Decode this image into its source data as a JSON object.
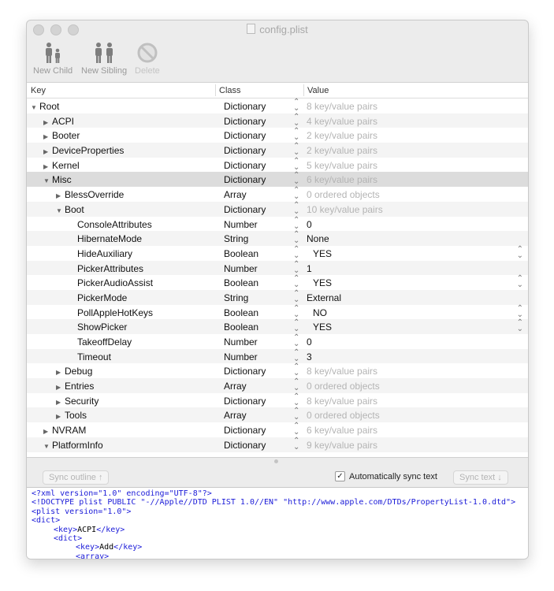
{
  "window": {
    "title": "config.plist"
  },
  "toolbar": {
    "new_child": "New Child",
    "new_sibling": "New Sibling",
    "delete": "Delete"
  },
  "table": {
    "headers": {
      "key": "Key",
      "class": "Class",
      "value": "Value"
    },
    "rows": [
      {
        "key": "Root",
        "class": "Dictionary",
        "value": "8 key/value pairs",
        "level": 0,
        "disc": "open",
        "kind": "dim"
      },
      {
        "key": "ACPI",
        "class": "Dictionary",
        "value": "4 key/value pairs",
        "level": 1,
        "disc": "closed",
        "kind": "dim"
      },
      {
        "key": "Booter",
        "class": "Dictionary",
        "value": "2 key/value pairs",
        "level": 1,
        "disc": "closed",
        "kind": "dim"
      },
      {
        "key": "DeviceProperties",
        "class": "Dictionary",
        "value": "2 key/value pairs",
        "level": 1,
        "disc": "closed",
        "kind": "dim"
      },
      {
        "key": "Kernel",
        "class": "Dictionary",
        "value": "5 key/value pairs",
        "level": 1,
        "disc": "closed",
        "kind": "dim"
      },
      {
        "key": "Misc",
        "class": "Dictionary",
        "value": "6 key/value pairs",
        "level": 1,
        "disc": "open",
        "kind": "dim",
        "selected": true
      },
      {
        "key": "BlessOverride",
        "class": "Array",
        "value": "0 ordered objects",
        "level": 2,
        "disc": "closed",
        "kind": "dim"
      },
      {
        "key": "Boot",
        "class": "Dictionary",
        "value": "10 key/value pairs",
        "level": 2,
        "disc": "open",
        "kind": "dim"
      },
      {
        "key": "ConsoleAttributes",
        "class": "Number",
        "value": "0",
        "level": 3,
        "disc": "none",
        "kind": "text"
      },
      {
        "key": "HibernateMode",
        "class": "String",
        "value": "None",
        "level": 3,
        "disc": "none",
        "kind": "text"
      },
      {
        "key": "HideAuxiliary",
        "class": "Boolean",
        "value": "YES",
        "level": 3,
        "disc": "none",
        "kind": "popup"
      },
      {
        "key": "PickerAttributes",
        "class": "Number",
        "value": "1",
        "level": 3,
        "disc": "none",
        "kind": "text"
      },
      {
        "key": "PickerAudioAssist",
        "class": "Boolean",
        "value": "YES",
        "level": 3,
        "disc": "none",
        "kind": "popup"
      },
      {
        "key": "PickerMode",
        "class": "String",
        "value": "External",
        "level": 3,
        "disc": "none",
        "kind": "text"
      },
      {
        "key": "PollAppleHotKeys",
        "class": "Boolean",
        "value": "NO",
        "level": 3,
        "disc": "none",
        "kind": "popup"
      },
      {
        "key": "ShowPicker",
        "class": "Boolean",
        "value": "YES",
        "level": 3,
        "disc": "none",
        "kind": "popup"
      },
      {
        "key": "TakeoffDelay",
        "class": "Number",
        "value": "0",
        "level": 3,
        "disc": "none",
        "kind": "text"
      },
      {
        "key": "Timeout",
        "class": "Number",
        "value": "3",
        "level": 3,
        "disc": "none",
        "kind": "text"
      },
      {
        "key": "Debug",
        "class": "Dictionary",
        "value": "8 key/value pairs",
        "level": 2,
        "disc": "closed",
        "kind": "dim"
      },
      {
        "key": "Entries",
        "class": "Array",
        "value": "0 ordered objects",
        "level": 2,
        "disc": "closed",
        "kind": "dim"
      },
      {
        "key": "Security",
        "class": "Dictionary",
        "value": "8 key/value pairs",
        "level": 2,
        "disc": "closed",
        "kind": "dim"
      },
      {
        "key": "Tools",
        "class": "Array",
        "value": "0 ordered objects",
        "level": 2,
        "disc": "closed",
        "kind": "dim"
      },
      {
        "key": "NVRAM",
        "class": "Dictionary",
        "value": "6 key/value pairs",
        "level": 1,
        "disc": "closed",
        "kind": "dim"
      },
      {
        "key": "PlatformInfo",
        "class": "Dictionary",
        "value": "9 key/value pairs",
        "level": 1,
        "disc": "open",
        "kind": "dim"
      }
    ]
  },
  "bottom": {
    "sync_outline": "Sync outline ↑",
    "auto_sync_label": "Automatically sync text",
    "auto_sync_checked": true,
    "sync_text": "Sync text ↓"
  },
  "xml_lines": [
    {
      "indent": 0,
      "parts": [
        [
          "t",
          "<?xml version=\"1.0\" encoding=\"UTF-8\"?>"
        ]
      ]
    },
    {
      "indent": 0,
      "parts": [
        [
          "t",
          "<!DOCTYPE plist PUBLIC \"-//Apple//DTD PLIST 1.0//EN\" \"http://www.apple.com/DTDs/PropertyList-1.0.dtd\">"
        ]
      ]
    },
    {
      "indent": 0,
      "parts": [
        [
          "t",
          "<plist version=\"1.0\">"
        ]
      ]
    },
    {
      "indent": 0,
      "parts": [
        [
          "t",
          "<dict>"
        ]
      ]
    },
    {
      "indent": 1,
      "parts": [
        [
          "t",
          "<key>"
        ],
        [
          "v",
          "ACPI"
        ],
        [
          "t",
          "</key>"
        ]
      ]
    },
    {
      "indent": 1,
      "parts": [
        [
          "t",
          "<dict>"
        ]
      ]
    },
    {
      "indent": 2,
      "parts": [
        [
          "t",
          "<key>"
        ],
        [
          "v",
          "Add"
        ],
        [
          "t",
          "</key>"
        ]
      ]
    },
    {
      "indent": 2,
      "parts": [
        [
          "t",
          "<array>"
        ]
      ]
    }
  ]
}
